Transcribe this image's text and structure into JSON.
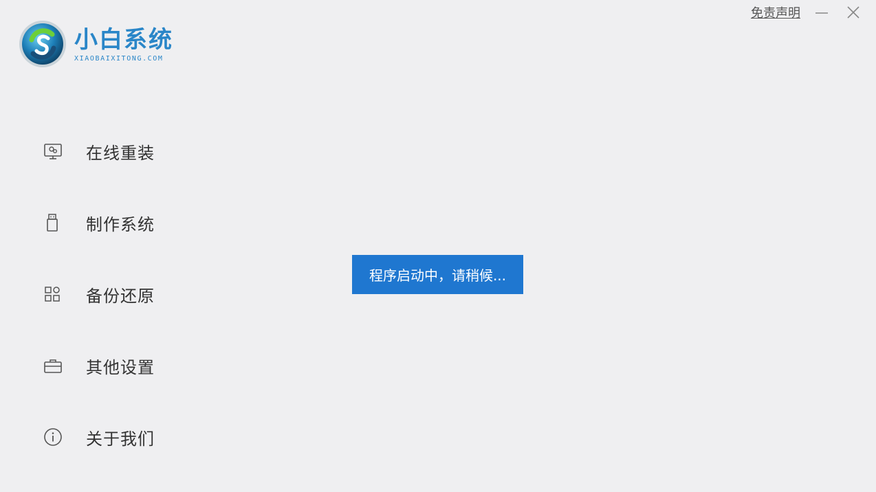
{
  "app": {
    "title": "小白系统",
    "subtitle": "XIAOBAIXITONG.COM"
  },
  "top_controls": {
    "disclaimer_label": "免责声明",
    "minimize_icon": "minimize-icon",
    "close_icon": "close-icon"
  },
  "nav": {
    "items": [
      {
        "label": "在线重装",
        "icon": "monitor-icon"
      },
      {
        "label": "制作系统",
        "icon": "usb-drive-icon"
      },
      {
        "label": "备份还原",
        "icon": "grid-icon"
      },
      {
        "label": "其他设置",
        "icon": "toolbox-icon"
      },
      {
        "label": "关于我们",
        "icon": "info-icon"
      }
    ]
  },
  "toast": {
    "message": "程序启动中，请稍候..."
  },
  "colors": {
    "brand": "#2a86c8",
    "toast_bg": "#1f77d0",
    "background": "#efeff1"
  }
}
